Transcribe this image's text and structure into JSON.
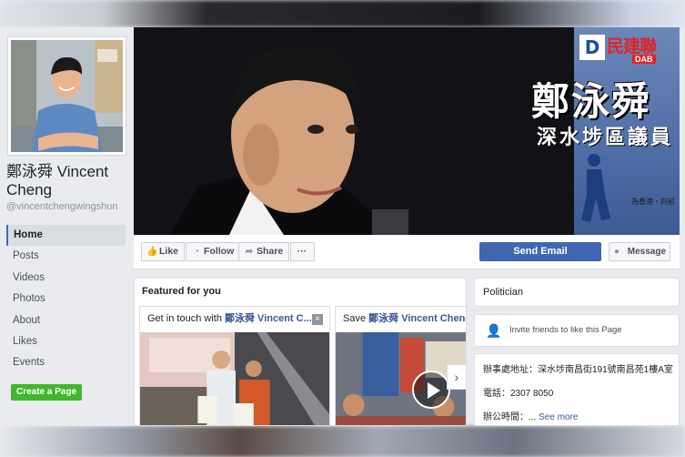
{
  "page": {
    "name": "鄭泳舜 Vincent Cheng",
    "username": "@vincentchengwingshun"
  },
  "nav": {
    "items": [
      "Home",
      "Posts",
      "Videos",
      "Photos",
      "About",
      "Likes",
      "Events"
    ],
    "active": "Home"
  },
  "create_page_label": "Create a Page",
  "cover": {
    "logo_cn": "民建聯",
    "logo_en": "DAB",
    "logo_letter": "D",
    "name": "鄭泳舜",
    "title": "深水埗區議員",
    "slogan": "為香港・向前"
  },
  "actions": {
    "like": "Like",
    "follow": "Follow",
    "share": "Share",
    "more": "···",
    "send_email": "Send Email",
    "message": "Message"
  },
  "featured": {
    "title": "Featured for you",
    "cards": [
      {
        "prefix": "Get in touch with ",
        "link": "鄭泳舜 Vincent C...",
        "close": "×"
      },
      {
        "prefix": "Save ",
        "link": "鄭泳舜 Vincent Cheng"
      }
    ],
    "next": "›"
  },
  "sidebar_right": {
    "category": "Politician",
    "invite": "Invite friends to like this Page",
    "address": "辦事處地址：深水埗南昌街191號南昌苑1樓A室",
    "phone": "電話：2307 8050",
    "hours_prefix": "辦公時間：... ",
    "see_more": "See more"
  },
  "colors": {
    "fb_blue": "#4267b2",
    "link_blue": "#365899",
    "create_green": "#42b72a",
    "dab_red": "#e02428"
  }
}
